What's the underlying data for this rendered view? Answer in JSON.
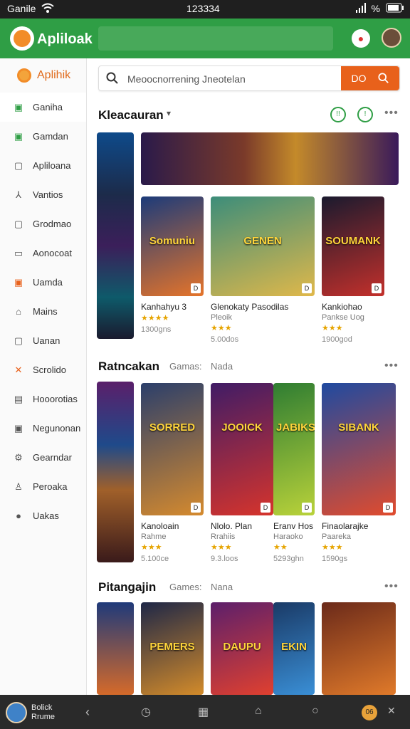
{
  "status": {
    "carrier": "Ganile",
    "time": "123334",
    "battery": "%"
  },
  "app": {
    "brand": "Apliloak"
  },
  "sidebar": {
    "header": "Aplihik",
    "items": [
      {
        "label": "Ganiha",
        "icon": "flag-icon",
        "color": "#2f9e45"
      },
      {
        "label": "Gamdan",
        "icon": "game-icon",
        "color": "#2f9e45"
      },
      {
        "label": "Apliloana",
        "icon": "app-icon",
        "color": "#555"
      },
      {
        "label": "Vantios",
        "icon": "tools-icon",
        "color": "#555"
      },
      {
        "label": "Grodmao",
        "icon": "grid-icon",
        "color": "#555"
      },
      {
        "label": "Aonocoat",
        "icon": "folder-icon",
        "color": "#555"
      },
      {
        "label": "Uamda",
        "icon": "calendar-icon",
        "color": "#e8611b"
      },
      {
        "label": "Mains",
        "icon": "home-icon",
        "color": "#555"
      },
      {
        "label": "Uanan",
        "icon": "document-icon",
        "color": "#555"
      },
      {
        "label": "Scrolido",
        "icon": "cross-icon",
        "color": "#e8611b"
      },
      {
        "label": "Hooorotias",
        "icon": "storage-icon",
        "color": "#555"
      },
      {
        "label": "Negunonan",
        "icon": "settings-icon",
        "color": "#555"
      },
      {
        "label": "Gearndar",
        "icon": "gear-icon",
        "color": "#555"
      },
      {
        "label": "Peroaka",
        "icon": "people-icon",
        "color": "#555"
      },
      {
        "label": "Uakas",
        "icon": "info-icon",
        "color": "#555"
      }
    ]
  },
  "search": {
    "placeholder": "Meoocnorrening Jneotelan",
    "button_label": "DO"
  },
  "sections": [
    {
      "title": "Kleacauran",
      "sub1": "",
      "sub2": "",
      "cards": [
        {
          "art": "Somuniu",
          "name": "Kanhahyu 3",
          "sub": "",
          "stars": "★★★★",
          "size": "1300gns",
          "badge": "D",
          "c1": "#1c3b7a",
          "c2": "#e5742a"
        },
        {
          "art": "GENEN",
          "name": "Glenokaty Pasodilas",
          "sub": "Pleoik",
          "stars": "★★★",
          "size": "5.00dos",
          "badge": "D",
          "c1": "#3c8d7a",
          "c2": "#e0b84a"
        },
        {
          "art": "SOUMANK",
          "name": "Kankiohao",
          "sub": "Pankse Uog",
          "stars": "★★★",
          "size": "1900god",
          "badge": "D",
          "c1": "#1a1a2e",
          "c2": "#c3302b"
        }
      ]
    },
    {
      "title": "Ratncakan",
      "sub1": "Gamas:",
      "sub2": "Nada",
      "cards": [
        {
          "art": "SORRED",
          "name": "Kanoloain",
          "sub": "Rahme",
          "stars": "★★★",
          "size": "5.100ce",
          "badge": "D",
          "c1": "#2b3f6b",
          "c2": "#d58a2e"
        },
        {
          "art": "JOOICK",
          "name": "Nlolo. Plan",
          "sub": "Rrahiis",
          "stars": "★★★",
          "size": "9.3.loos",
          "badge": "D",
          "c1": "#401c66",
          "c2": "#d6342c"
        },
        {
          "art": "JABIKS",
          "name": "Eranv Hos",
          "sub": "Haraoko",
          "stars": "★★",
          "size": "5293ghn",
          "badge": "D",
          "c1": "#2f7d32",
          "c2": "#b9d23a"
        },
        {
          "art": "SIBANK",
          "name": "Finaolarajke",
          "sub": "Paareka",
          "stars": "★★★",
          "size": "1590gs",
          "badge": "D",
          "c1": "#1f4aa0",
          "c2": "#e14b2d"
        }
      ]
    },
    {
      "title": "Pitangajin",
      "sub1": "Games:",
      "sub2": "Nana",
      "cards": [
        {
          "art": "PEMERS",
          "name": "",
          "sub": "",
          "stars": "",
          "size": "",
          "badge": "",
          "c1": "#1e2747",
          "c2": "#d38b2a"
        },
        {
          "art": "DAUPU",
          "name": "",
          "sub": "",
          "stars": "",
          "size": "",
          "badge": "",
          "c1": "#5c1f6b",
          "c2": "#e0402f"
        },
        {
          "art": "EKIN",
          "name": "",
          "sub": "",
          "stars": "",
          "size": "",
          "badge": "",
          "c1": "#1a3a66",
          "c2": "#3a8fd6"
        },
        {
          "art": "",
          "name": "",
          "sub": "",
          "stars": "",
          "size": "",
          "badge": "",
          "c1": "#6b2a1a",
          "c2": "#e07a2a"
        }
      ]
    }
  ],
  "footer": {
    "user_line1": "Bolick",
    "user_line2": "Rrume",
    "coin": "06"
  }
}
